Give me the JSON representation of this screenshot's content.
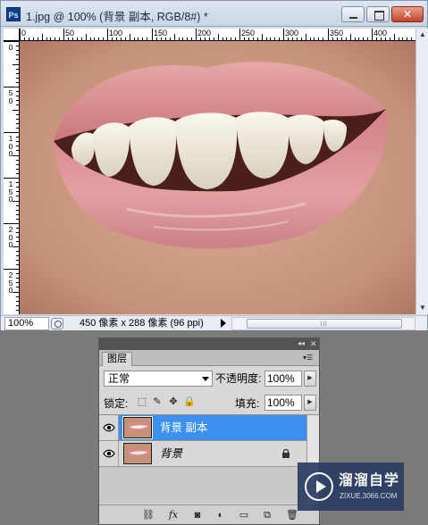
{
  "document": {
    "title": "1.jpg @ 100% (背景 副本, RGB/8#) *",
    "zoom": "100%",
    "doc_info": "450 像素 x 288 像素 (96 ppi)",
    "app_icon_text": "Ps"
  },
  "rulers": {
    "horizontal": [
      "0",
      "50",
      "100",
      "150",
      "200",
      "250",
      "300",
      "350",
      "400"
    ],
    "vertical": [
      "0",
      "5\n0",
      "1\n0\n0",
      "1\n5\n0",
      "2\n0\n0",
      "2\n5\n0"
    ]
  },
  "layers_panel": {
    "tab": "图层",
    "blend_mode": "正常",
    "opacity_label": "不透明度:",
    "opacity_value": "100%",
    "lock_label": "锁定:",
    "fill_label": "填充:",
    "fill_value": "100%",
    "layers": [
      {
        "name": "背景 副本",
        "selected": true,
        "visible": true,
        "locked": false
      },
      {
        "name": "背景",
        "selected": false,
        "visible": true,
        "locked": true
      }
    ]
  },
  "watermark": {
    "title": "溜溜自学",
    "url": "ZIXUE.3066.COM"
  },
  "colors": {
    "selection": "#3d8ff0",
    "panel_bg": "#d8d8d8",
    "workspace_bg": "#7a7a7a"
  },
  "icons": [
    "photoshop-icon",
    "minimize-icon",
    "maximize-icon",
    "close-icon",
    "eye-icon",
    "lock-icon",
    "link-icon",
    "fx-icon",
    "mask-icon",
    "adjustment-icon",
    "folder-icon",
    "new-layer-icon",
    "trash-icon"
  ]
}
